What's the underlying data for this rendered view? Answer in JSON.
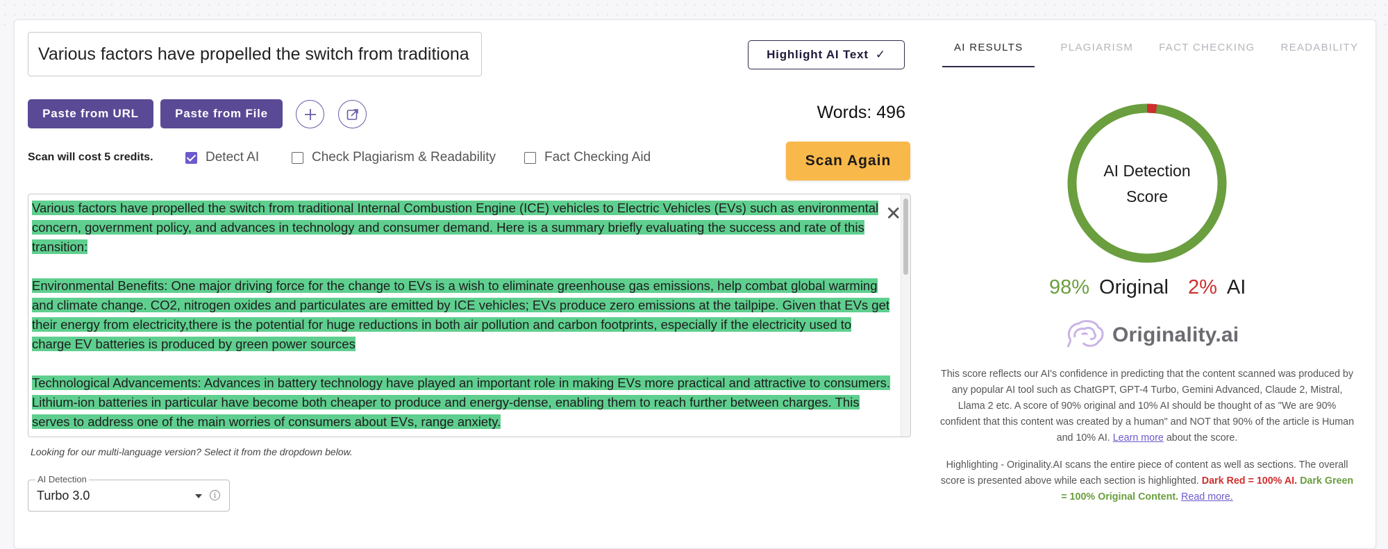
{
  "editor": {
    "title_value": "Various factors have propelled the switch from traditiona",
    "highlight_label": "Highlight AI Text",
    "paste_url_label": "Paste from URL",
    "paste_file_label": "Paste from File",
    "words_label": "Words: 496",
    "credits_text": "Scan will cost 5 credits.",
    "options": [
      {
        "label": "Detect AI",
        "checked": true
      },
      {
        "label": "Check Plagiarism & Readability",
        "checked": false
      },
      {
        "label": "Fact Checking Aid",
        "checked": false
      }
    ],
    "scan_label": "Scan Again",
    "paragraphs": [
      "Various factors have propelled the switch from traditional Internal Combustion Engine (ICE) vehicles to Electric Vehicles (EVs) such as environmental concern, government policy, and advances in technology and consumer demand. Here is a summary briefly evaluating the success and rate of this transition:",
      "Environmental Benefits: One major driving force for the change to EVs is a wish to eliminate greenhouse gas emissions, help combat global warming and climate change. CO2, nitrogen oxides and particulates are emitted by ICE vehicles; EVs produce zero emissions at the tailpipe. Given that EVs get their energy from electricity,there is the potential for huge reductions in both air pollution and carbon footprints, especially if the electricity used to charge EV batteries is produced by green power sources",
      "Technological Advancements: Advances in battery technology have played an important role in making EVs more practical and attractive to consumers. Lithium-ion batteries in particular have become both cheaper to produce and energy-dense, enabling them to reach further between charges. This serves to address one of the main worries of consumers about EVs, range anxiety."
    ],
    "hint": "Looking for our multi-language version? Select it from the dropdown below.",
    "model_select": {
      "legend": "AI Detection",
      "value": "Turbo 3.0"
    }
  },
  "results": {
    "tabs": [
      "AI RESULTS",
      "PLAGIARISM",
      "FACT CHECKING",
      "READABILITY"
    ],
    "active_tab": 0,
    "donut_label_line1": "AI Detection",
    "donut_label_line2": "Score",
    "original_pct": "98%",
    "original_label": "Original",
    "ai_pct": "2%",
    "ai_label": "AI",
    "original_fraction": 0.98,
    "ai_fraction": 0.02,
    "brand": "Originality.ai",
    "desc_text": "This score reflects our AI's confidence in predicting that the content scanned was produced by any popular AI tool such as ChatGPT, GPT-4 Turbo, Gemini Advanced, Claude 2, Mistral, Llama 2 etc. A score of 90% original and 10% AI should be thought of as \"We are 90% confident that this content was created by a human\" and NOT that 90% of the article is Human and 10% AI.",
    "learn_more": "Learn more",
    "desc_tail": "about the score.",
    "highlight_text": "Highlighting - Originality.AI scans the entire piece of content as well as sections. The overall score is presented above while each section is highlighted.",
    "dark_red_text": "Dark Red = 100% AI.",
    "dark_green_text": "Dark Green = 100% Original Content.",
    "read_more": "Read more.",
    "colors": {
      "original": "#6a9e3f",
      "ai": "#cf2e2e",
      "accent": "#5a4a96",
      "scan": "#f9b84a",
      "highlight": "#5fcf8f"
    }
  }
}
